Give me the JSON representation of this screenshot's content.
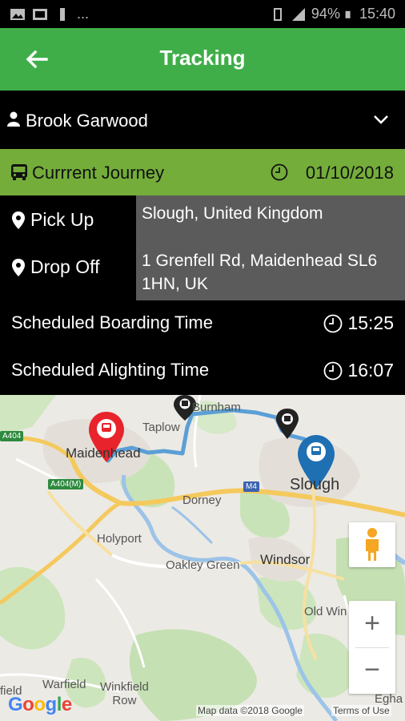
{
  "status_bar": {
    "battery": "94%",
    "time": "15:40",
    "more": "..."
  },
  "app_bar": {
    "title": "Tracking"
  },
  "user": {
    "name": "Brook Garwood"
  },
  "journey": {
    "label": "Currrent Journey",
    "date": "01/10/2018"
  },
  "locations": {
    "pickup_label": "Pick Up",
    "pickup_value": "Slough, United Kingdom",
    "dropoff_label": "Drop Off",
    "dropoff_value": "1 Grenfell Rd, Maidenhead SL6 1HN, UK"
  },
  "schedule": {
    "boarding_label": "Scheduled Boarding Time",
    "boarding_time": "15:25",
    "alighting_label": "Scheduled Alighting Time",
    "alighting_time": "16:07"
  },
  "map": {
    "places": {
      "burnham": "Burnham",
      "taplow": "Taplow",
      "maidenhead": "Maidenhead",
      "slough": "Slough",
      "dorney": "Dorney",
      "holyport": "Holyport",
      "oakley_green": "Oakley Green",
      "windsor": "Windsor",
      "old_windsor": "Old Win",
      "warfield": "Warfield",
      "winkfield_row": "Winkfield\nRow",
      "field": "field",
      "egham": "Egha"
    },
    "roads": {
      "a404": "A404",
      "a404m": "A404(M)",
      "m4": "M4"
    },
    "zoom_in": "+",
    "zoom_out": "−",
    "logo": "Google",
    "map_data": "Map data ©2018 Google",
    "terms": "Terms of Use"
  },
  "colors": {
    "app_bar": "#3fae49",
    "journey_bar": "#74ad3a",
    "route": "#5b9fd6",
    "dropoff_pin": "#e8232b",
    "pickup_pin": "#1f6fb3"
  }
}
